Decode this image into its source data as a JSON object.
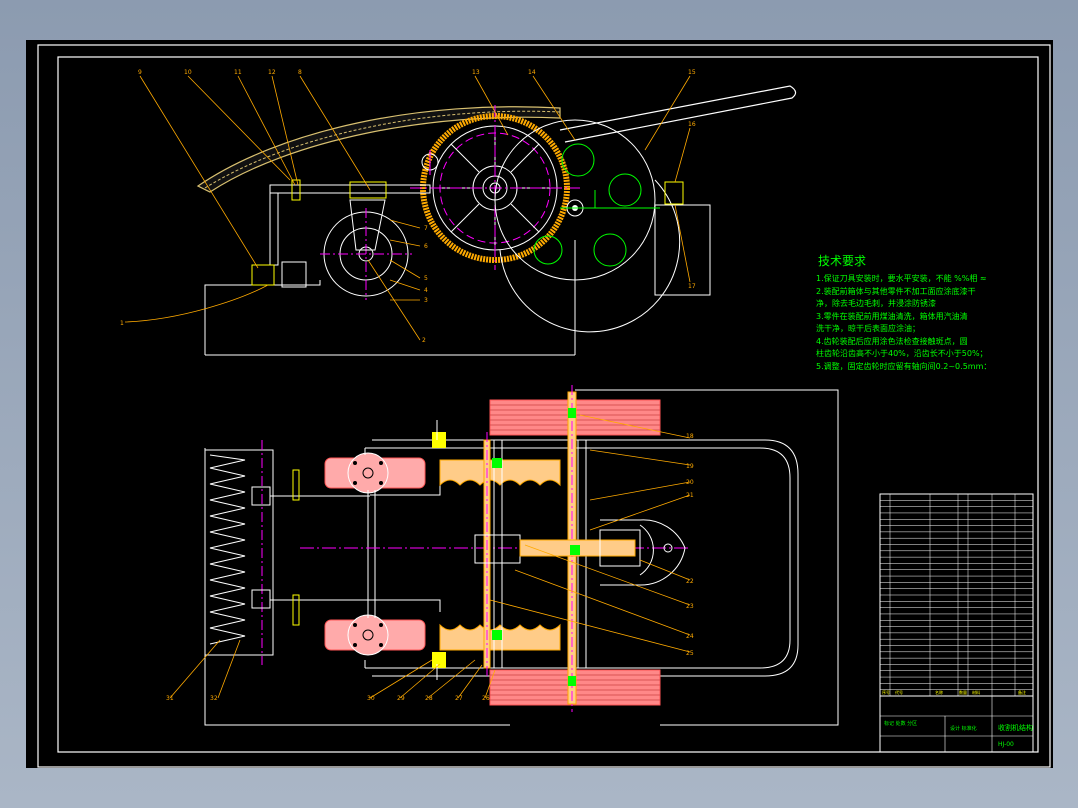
{
  "drawing": {
    "tech_title": "技术要求",
    "tech_lines": [
      "1.保证刀具安装时，要水平安装，不能 %%相 ≈",
      "2.装配前箱体与其他零件不加工面应涂底漆干",
      "净，除去毛边毛刺，并浸涂防锈漆",
      "3.零件在装配前用煤油清洗，箱体用汽油清",
      "洗干净，晾干后表面应涂油；",
      "4.齿轮装配后应用涂色法检查接触斑点，圆",
      "柱齿轮沿齿高不小于40%，沿齿长不小于50%；",
      "5.调整，固定齿轮时应留有轴向间0.2~0.5mm："
    ],
    "top_view_labels": [
      "9",
      "10",
      "11",
      "12",
      "8",
      "13",
      "14",
      "15",
      "16",
      "17",
      "1",
      "2",
      "3",
      "4",
      "5",
      "6",
      "7"
    ],
    "bottom_view_labels": [
      "18",
      "19",
      "20",
      "21",
      "22",
      "23",
      "24",
      "25",
      "31",
      "32",
      "30",
      "29",
      "28",
      "27",
      "26"
    ],
    "title_block": {
      "name": "收割机结构",
      "code": "HJ-00",
      "footer_left": "标记 处数 分区",
      "footer_mid": "设计 标准化",
      "bom_header": [
        "序号",
        "代号",
        "名称",
        "数量",
        "材料",
        "备注"
      ]
    }
  },
  "colors": {
    "background": "#000000",
    "frame": "#ffffff",
    "outline": "#ffffff",
    "center": "#ff00ff",
    "section": "#ffaa00",
    "dim": "#ffff00",
    "green": "#00ff00",
    "red": "#ff3333",
    "pink": "#ff8888"
  }
}
